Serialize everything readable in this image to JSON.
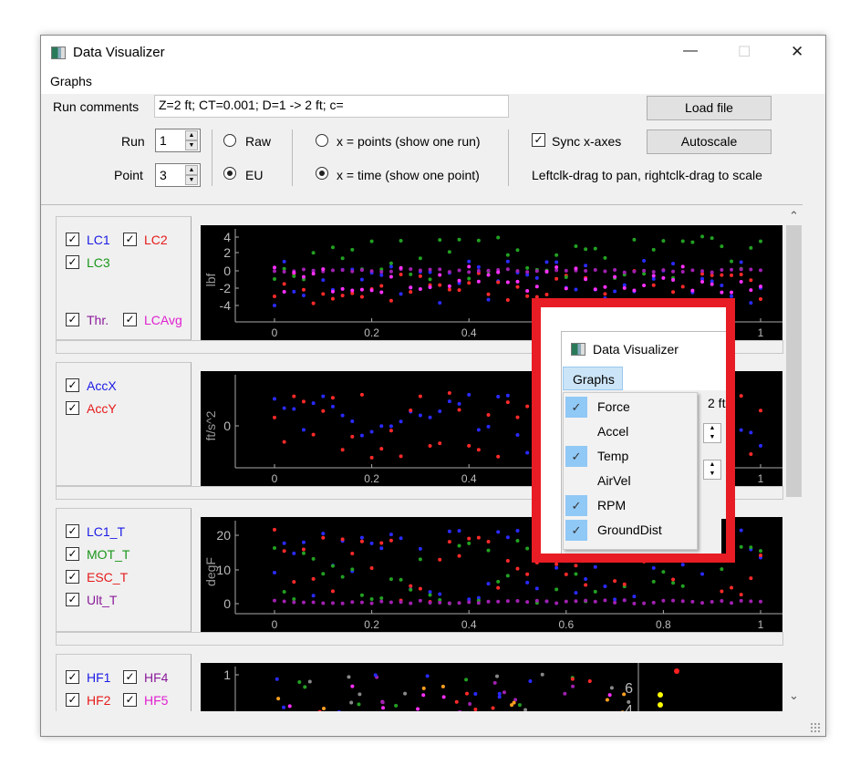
{
  "window": {
    "title": "Data Visualizer",
    "controls": {
      "minimize": "—",
      "maximize": "☐",
      "close": "✕"
    }
  },
  "menu": {
    "graphs": "Graphs"
  },
  "controls": {
    "run_comments_label": "Run comments",
    "run_comments_value": "Z=2 ft; CT=0.001; D=1 -> 2 ft; c=",
    "run_label": "Run",
    "run_value": "1",
    "point_label": "Point",
    "point_value": "3",
    "raw_label": "Raw",
    "eu_label": "EU",
    "units_selected": "EU",
    "xpoints_label": "x = points (show one run)",
    "xtime_label": "x = time (show one point)",
    "x_selected": "time",
    "sync_label": "Sync x-axes",
    "sync_checked": true,
    "load_file": "Load file",
    "autoscale": "Autoscale",
    "hint": "Leftclk-drag to pan, rightclk-drag to scale"
  },
  "panels": [
    {
      "channels": [
        {
          "label": "LC1",
          "color": "#1a1ae6"
        },
        {
          "label": "LC2",
          "color": "#e61a1a"
        },
        {
          "label": "LC3",
          "color": "#1a961a"
        },
        {
          "label": "Thr.",
          "color": "#8a1a9a"
        },
        {
          "label": "LCAvg",
          "color": "#e020d0"
        }
      ],
      "ylabel": "lbf",
      "yticks": [
        "4",
        "2",
        "0",
        "-2",
        "-4"
      ],
      "xticks": [
        "0",
        "0.2",
        "0.4",
        "0.6",
        "0.8",
        "1"
      ]
    },
    {
      "channels": [
        {
          "label": "AccX",
          "color": "#1a1ae6"
        },
        {
          "label": "AccY",
          "color": "#e61a1a"
        }
      ],
      "ylabel": "ft/s^2",
      "yticks": [
        "0"
      ],
      "xticks": [
        "0",
        "0.2",
        "0.4",
        "0.6",
        "0.8",
        "1"
      ]
    },
    {
      "channels": [
        {
          "label": "LC1_T",
          "color": "#1a1ae6"
        },
        {
          "label": "MOT_T",
          "color": "#1a961a"
        },
        {
          "label": "ESC_T",
          "color": "#e61a1a"
        },
        {
          "label": "Ult_T",
          "color": "#8a1a9a"
        }
      ],
      "ylabel": "degF",
      "yticks": [
        "20",
        "10",
        "0"
      ],
      "xticks": [
        "0",
        "0.2",
        "0.4",
        "0.6",
        "0.8",
        "1"
      ]
    },
    {
      "channels": [
        {
          "label": "HF1",
          "color": "#1a1ae6"
        },
        {
          "label": "HF4",
          "color": "#8a1a9a"
        },
        {
          "label": "HF2",
          "color": "#e61a1a"
        },
        {
          "label": "HF5",
          "color": "#e020d0"
        }
      ],
      "ylabel": "s",
      "yticks": [
        "1"
      ],
      "y2ticks": [
        "6",
        "4"
      ],
      "xticks": []
    }
  ],
  "overlay": {
    "title": "Data Visualizer",
    "menu": "Graphs",
    "behind_text": "2 ft; C",
    "items": [
      {
        "label": "Force",
        "checked": true
      },
      {
        "label": "Accel",
        "checked": false
      },
      {
        "label": "Temp",
        "checked": true
      },
      {
        "label": "AirVel",
        "checked": false
      },
      {
        "label": "RPM",
        "checked": true
      },
      {
        "label": "GroundDist",
        "checked": true
      }
    ],
    "behind_checkbox": "LC3"
  },
  "scrollbar": {
    "up": "⌃",
    "down": "⌄"
  }
}
